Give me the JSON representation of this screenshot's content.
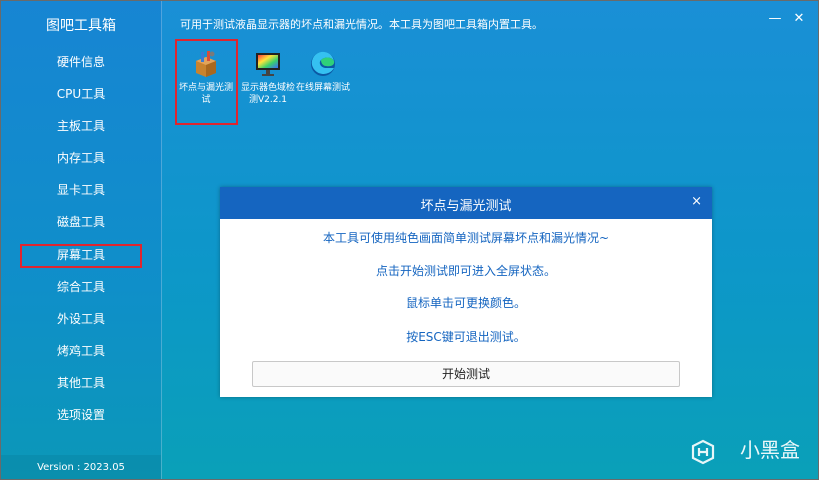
{
  "sidebar": {
    "title": "图吧工具箱",
    "items": [
      {
        "label": "硬件信息"
      },
      {
        "label": "CPU工具"
      },
      {
        "label": "主板工具"
      },
      {
        "label": "内存工具"
      },
      {
        "label": "显卡工具"
      },
      {
        "label": "磁盘工具"
      },
      {
        "label": "屏幕工具"
      },
      {
        "label": "综合工具"
      },
      {
        "label": "外设工具"
      },
      {
        "label": "烤鸡工具"
      },
      {
        "label": "其他工具"
      },
      {
        "label": "选项设置"
      }
    ],
    "selected": "屏幕工具",
    "version": "Version : 2023.05"
  },
  "infobar": {
    "text": "可用于测试液晶显示器的坏点和漏光情况。本工具为图吧工具箱内置工具。",
    "minimize": "—",
    "close": "✕"
  },
  "tools": [
    {
      "label": "坏点与漏光测试",
      "icon": "box-tools-icon"
    },
    {
      "label": "显示器色域检测V2.2.1",
      "icon": "monitor-color-icon"
    },
    {
      "label": "在线屏幕测试",
      "icon": "edge-browser-icon"
    }
  ],
  "dialog": {
    "title": "坏点与漏光测试",
    "close": "×",
    "lines": [
      "本工具可使用纯色画面简单测试屏幕坏点和漏光情况~",
      "点击开始测试即可进入全屏状态。",
      "鼠标单击可更换颜色。",
      "按ESC键可退出测试。"
    ],
    "start_button": "开始测试"
  },
  "watermark": {
    "text": "小黑盒"
  },
  "colors": {
    "highlight": "#e0252e",
    "dialog_header": "#1565c0"
  }
}
